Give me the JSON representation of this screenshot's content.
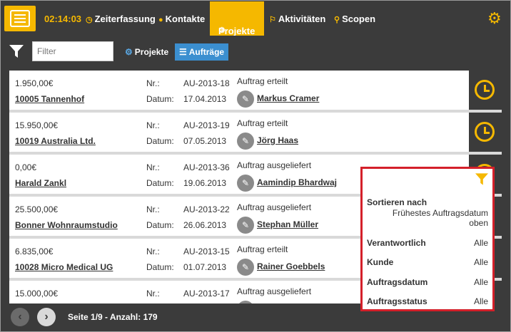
{
  "topbar": {
    "time": "02:14:03",
    "nav": [
      {
        "label": "Zeiterfassung",
        "icon": "clock-icon"
      },
      {
        "label": "Kontakte",
        "icon": "person-icon"
      },
      {
        "label": "Projekte",
        "icon": "gears-icon"
      },
      {
        "label": "Aktivitäten",
        "icon": "flag-icon"
      },
      {
        "label": "Scopen",
        "icon": "search-icon"
      }
    ],
    "active_nav": "Projekte",
    "accent": "#f5b800"
  },
  "filterbar": {
    "placeholder": "Filter",
    "tabs": [
      {
        "label": "Projekte",
        "icon": "gears-icon"
      },
      {
        "label": "Aufträge",
        "icon": "list-icon"
      }
    ],
    "active_tab": "Aufträge"
  },
  "orders": [
    {
      "amount": "1.950,00€",
      "name": "10005 Tannenhof",
      "nr_label": "Nr.:",
      "nr": "AU-2013-18",
      "date_label": "Datum:",
      "date": "17.04.2013",
      "status": "Auftrag erteilt",
      "person": "Markus Cramer"
    },
    {
      "amount": "15.950,00€",
      "name": "10019 Australia Ltd.",
      "nr_label": "Nr.:",
      "nr": "AU-2013-19",
      "date_label": "Datum:",
      "date": "07.05.2013",
      "status": "Auftrag erteilt",
      "person": "Jörg Haas"
    },
    {
      "amount": "0,00€",
      "name": "Harald Zankl",
      "nr_label": "Nr.:",
      "nr": "AU-2013-36",
      "date_label": "Datum:",
      "date": "19.06.2013",
      "status": "Auftrag ausgeliefert",
      "person": "Aamindip Bhardwaj"
    },
    {
      "amount": "25.500,00€",
      "name": "Bonner Wohnraumstudio",
      "nr_label": "Nr.:",
      "nr": "AU-2013-22",
      "date_label": "Datum:",
      "date": "26.06.2013",
      "status": "Auftrag ausgeliefert",
      "person": "Stephan Müller"
    },
    {
      "amount": "6.835,00€",
      "name": "10028 Micro Medical UG",
      "nr_label": "Nr.:",
      "nr": "AU-2013-15",
      "date_label": "Datum:",
      "date": "01.07.2013",
      "status": "Auftrag erteilt",
      "person": "Rainer Goebbels"
    },
    {
      "amount": "15.000,00€",
      "name": "",
      "nr_label": "Nr.:",
      "nr": "AU-2013-17",
      "date_label": "",
      "date": "",
      "status": "Auftrag ausgeliefert",
      "person": ""
    }
  ],
  "pagination": {
    "info": "Seite 1/9 - Anzahl: 179"
  },
  "sort_popup": {
    "sort_label": "Sortieren nach",
    "sort_value": "Frühestes Auftragsdatum oben",
    "filters": [
      {
        "label": "Verantwortlich",
        "value": "Alle"
      },
      {
        "label": "Kunde",
        "value": "Alle"
      },
      {
        "label": "Auftragsdatum",
        "value": "Alle"
      },
      {
        "label": "Auftragsstatus",
        "value": "Alle"
      }
    ],
    "border_color": "#d4202a"
  }
}
